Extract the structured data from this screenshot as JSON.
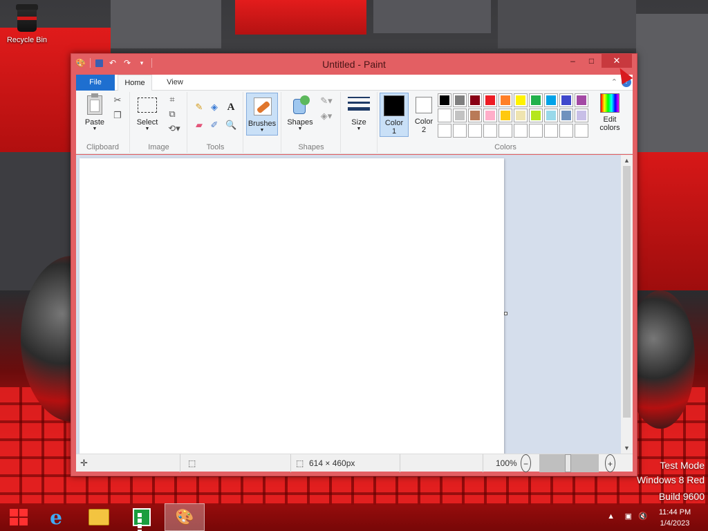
{
  "desktop": {
    "recycle_bin_label": "Recycle Bin",
    "watermark": [
      "Test Mode",
      "Windows 8 Red",
      "Build 9600"
    ]
  },
  "window": {
    "title": "Untitled - Paint",
    "controls": {
      "minimize": "–",
      "maximize": "□",
      "close": "✕"
    }
  },
  "tabs": {
    "file": "File",
    "home": "Home",
    "view": "View"
  },
  "ribbon": {
    "clipboard": {
      "label": "Clipboard",
      "paste": "Paste"
    },
    "image": {
      "label": "Image",
      "select": "Select"
    },
    "tools": {
      "label": "Tools",
      "text_tool": "A"
    },
    "brushes": {
      "label": "Brushes"
    },
    "shapes": {
      "label": "Shapes",
      "shapes_btn": "Shapes"
    },
    "size": {
      "label": "Size"
    },
    "colors": {
      "label": "Colors",
      "color1": "Color 1",
      "color1_line1": "Color",
      "color1_line2": "1",
      "color2_line1": "Color",
      "color2_line2": "2",
      "edit_line1": "Edit",
      "edit_line2": "colors",
      "color1_value": "#000000",
      "color2_value": "#ffffff",
      "palette_row1": [
        "#000000",
        "#7f7f7f",
        "#880015",
        "#ed1c24",
        "#ff7f27",
        "#fff200",
        "#22b14c",
        "#00a2e8",
        "#3f48cc",
        "#a349a4"
      ],
      "palette_row2": [
        "#ffffff",
        "#c3c3c3",
        "#b97a57",
        "#ffaec9",
        "#ffc90e",
        "#efe4b0",
        "#b5e61d",
        "#99d9ea",
        "#7092be",
        "#c8bfe7"
      ],
      "palette_row3": [
        "#ffffff",
        "#ffffff",
        "#ffffff",
        "#ffffff",
        "#ffffff",
        "#ffffff",
        "#ffffff",
        "#ffffff",
        "#ffffff",
        "#ffffff"
      ]
    }
  },
  "status": {
    "canvas_size": "614 × 460px",
    "zoom": "100%"
  },
  "taskbar": {
    "time": "11:44 PM",
    "date": "1/4/2023"
  }
}
